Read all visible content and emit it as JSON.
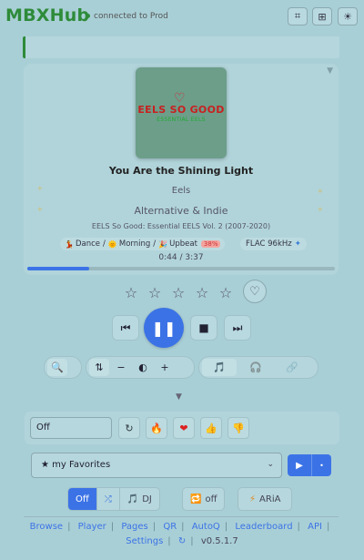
{
  "header": {
    "logo": "MBXHub",
    "connection": "connected to Prod",
    "buttons": [
      {
        "name": "qr-scan-icon",
        "glyph": "⌗"
      },
      {
        "name": "grid-view-icon",
        "glyph": "⊞"
      },
      {
        "name": "theme-sun-icon",
        "glyph": "☀"
      }
    ]
  },
  "now_playing": {
    "album_art": {
      "heart": "♡",
      "line1": "EELS SO GOOD",
      "line2": "ESSENTIAL EELS"
    },
    "title": "You Are the Shining Light",
    "artist": "Eels",
    "genre": "Alternative & Indie",
    "album": "EELS So Good: Essential EELS Vol. 2 (2007-2020)",
    "tags": {
      "items": [
        {
          "emoji": "💃",
          "label": "Dance"
        },
        {
          "emoji": "🌞",
          "label": "Morning"
        },
        {
          "emoji": "🎉",
          "label": "Upbeat"
        }
      ],
      "energy_pct": "38%"
    },
    "quality": "FLAC 96kHz",
    "quality_badge": "✦",
    "time": "0:44 / 3:37",
    "progress": 0.2
  },
  "rating": {
    "stars": 5,
    "star_glyph": "☆",
    "love_glyph": "♡"
  },
  "transport": {
    "prev": "⏮",
    "play": "❚❚",
    "stop": "■",
    "next": "⏭"
  },
  "toolbar": {
    "search": "🔍",
    "volume_icon": "⇅",
    "vol_down": "−",
    "vol_indicator": "◐",
    "vol_up": "+",
    "music_note": "🎵",
    "headphones": "🎧",
    "link": "🔗"
  },
  "expand_chevron": "▼",
  "mood_panel": {
    "mode_value": "Off",
    "buttons": [
      {
        "name": "refresh-button",
        "glyph": "↻"
      },
      {
        "name": "fire-button",
        "glyph": "🔥"
      },
      {
        "name": "heart-button",
        "glyph": "❤"
      },
      {
        "name": "thumbs-up-button",
        "glyph": "👍"
      },
      {
        "name": "thumbs-down-button",
        "glyph": "👎"
      }
    ]
  },
  "playlist": {
    "selected": "★ my Favorites",
    "arrow": "⌄",
    "play": "▶",
    "more": "•"
  },
  "modes": {
    "group1": [
      {
        "label": "Off",
        "active": true,
        "icon": ""
      },
      {
        "label": "",
        "active": false,
        "icon": "⤮"
      },
      {
        "label": "DJ",
        "active": false,
        "icon": "🎵"
      }
    ],
    "repeat": {
      "icon": "🔁",
      "label": "off"
    },
    "aria": {
      "icon": "⚡",
      "label": "ARiA"
    }
  },
  "footer": {
    "links": [
      "Browse",
      "Player",
      "Pages",
      "QR",
      "AutoQ",
      "Leaderboard",
      "API"
    ],
    "settings": "Settings",
    "refresh": "↻",
    "version": "v0.5.1.7"
  }
}
